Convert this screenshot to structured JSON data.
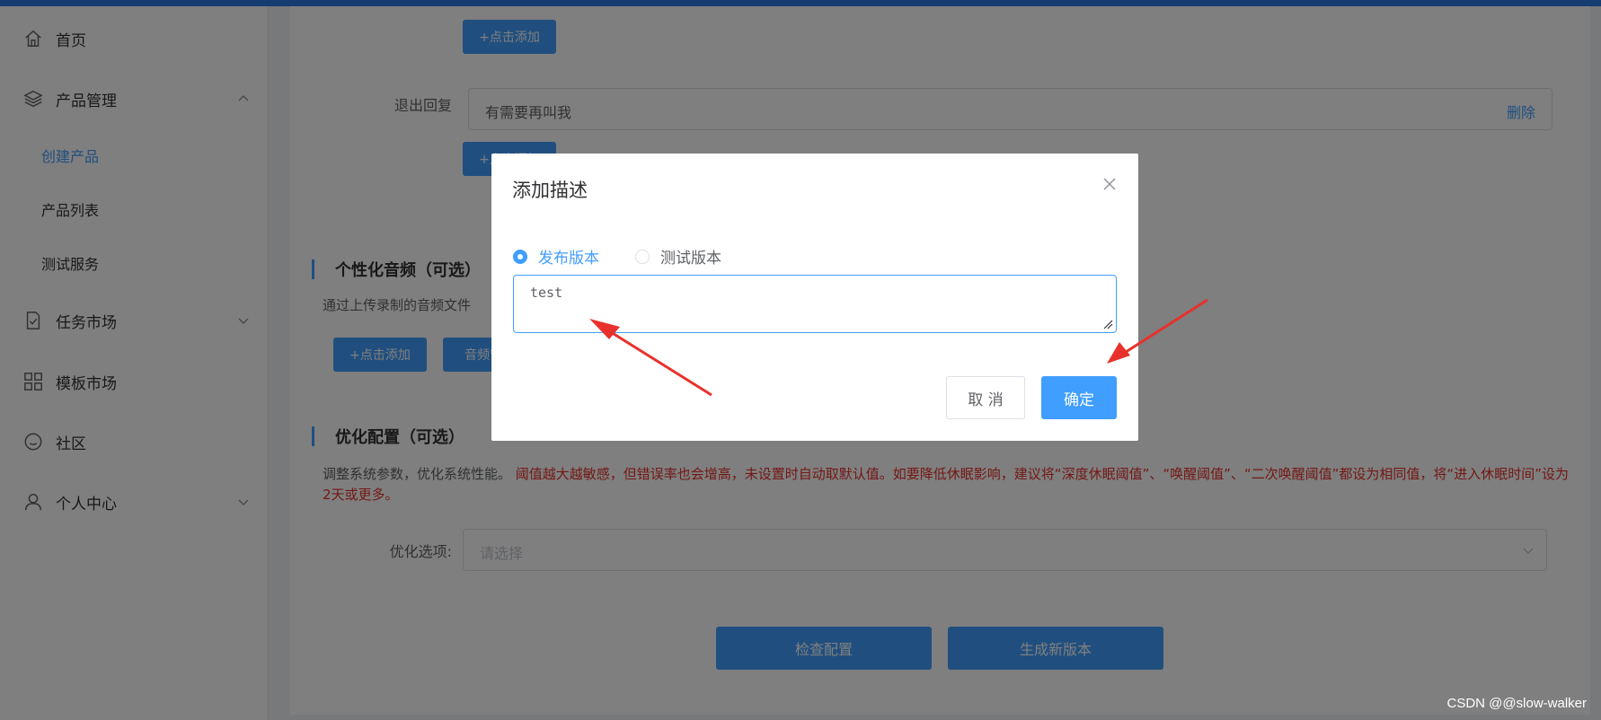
{
  "sidebar": {
    "items": [
      {
        "label": "首页",
        "icon": "home-icon"
      },
      {
        "label": "产品管理",
        "icon": "layers-icon"
      },
      {
        "label": "任务市场",
        "icon": "task-doc-icon"
      },
      {
        "label": "模板市场",
        "icon": "grid-icon"
      },
      {
        "label": "社区",
        "icon": "smile-icon"
      },
      {
        "label": "个人中心",
        "icon": "user-icon"
      }
    ],
    "sub_items": [
      {
        "label": "创建产品",
        "active": true
      },
      {
        "label": "产品列表",
        "active": false
      },
      {
        "label": "测试服务",
        "active": false
      }
    ]
  },
  "main": {
    "add_button_top": "+点击添加",
    "exit_reply_label": "退出回复",
    "exit_reply_value": "有需要再叫我",
    "exit_reply_delete": "删除",
    "add_button_exit": "+点击添加",
    "audio_section_title": "个性化音频（可选）",
    "audio_section_desc": "通过上传录制的音频文件",
    "audio_add_button": "+点击添加",
    "audio_manage_button": "音频管理",
    "optimize_section_title": "优化配置（可选）",
    "optimize_desc_normal": "调整系统参数，优化系统性能。",
    "optimize_desc_red": "阈值越大越敏感，但错误率也会增高，未设置时自动取默认值。如要降低休眠影响，建议将“深度休眠阈值”、“唤醒阈值”、“二次唤醒阈值”都设为相同值，将“进入休眠时间”设为2天或更多。",
    "optimize_option_label": "优化选项:",
    "optimize_option_placeholder": "请选择",
    "check_config_button": "检查配置",
    "generate_version_button": "生成新版本"
  },
  "dialog": {
    "title": "添加描述",
    "radio_release": "发布版本",
    "radio_test": "测试版本",
    "selected": "发布版本",
    "description_value": "test",
    "cancel_label": "取 消",
    "confirm_label": "确定"
  },
  "watermark": "CSDN @@slow-walker",
  "colors": {
    "primary": "#409eff",
    "annotation_arrow": "#e8312c",
    "warning_text": "#e6302a",
    "topbar": "#2d7be5"
  }
}
